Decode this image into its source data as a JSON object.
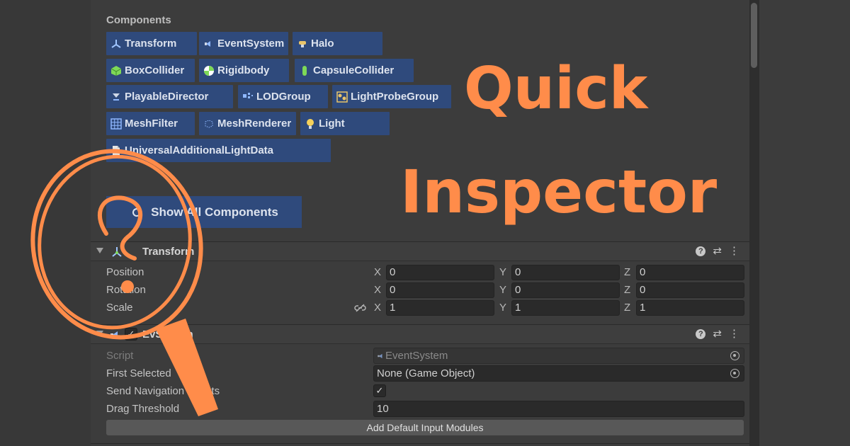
{
  "components_header": "Components",
  "chips": [
    {
      "label": "Transform",
      "icon": "transform-icon"
    },
    {
      "label": "EventSystem",
      "icon": "eventsystem-icon"
    },
    {
      "label": "Halo",
      "icon": "halo-icon"
    },
    {
      "label": "BoxCollider",
      "icon": "boxcollider-icon"
    },
    {
      "label": "Rigidbody",
      "icon": "rigidbody-icon"
    },
    {
      "label": "CapsuleCollider",
      "icon": "capsulecollider-icon"
    },
    {
      "label": "PlayableDirector",
      "icon": "playabledirector-icon"
    },
    {
      "label": "LODGroup",
      "icon": "lodgroup-icon"
    },
    {
      "label": "LightProbeGroup",
      "icon": "lightprobegroup-icon"
    },
    {
      "label": "MeshFilter",
      "icon": "meshfilter-icon"
    },
    {
      "label": "MeshRenderer",
      "icon": "meshrenderer-icon"
    },
    {
      "label": "Light",
      "icon": "light-icon"
    },
    {
      "label": "UniversalAdditionalLightData",
      "icon": "script-icon"
    }
  ],
  "show_all_label": "Show All Components",
  "transform": {
    "title": "Transform",
    "rows": [
      {
        "label": "Position",
        "x": "0",
        "y": "0",
        "z": "0"
      },
      {
        "label": "Rotation",
        "x": "0",
        "y": "0",
        "z": "0"
      },
      {
        "label": "Scale",
        "x": "1",
        "y": "1",
        "z": "1"
      }
    ],
    "axis_x": "X",
    "axis_y": "Y",
    "axis_z": "Z"
  },
  "eventsystem": {
    "title": "EventSystem",
    "title_visible": "Ev",
    "title_visible_tail": "System",
    "script_label": "Script",
    "script_value": "EventSystem",
    "first_selected_label": "First Selected",
    "first_selected_value": "None (Game Object)",
    "send_nav_label": "Send Navigation Events",
    "send_nav_checked": true,
    "drag_threshold_label": "Drag Threshold",
    "drag_threshold_value": "10",
    "add_modules_label": "Add Default Input Modules"
  },
  "overlay": {
    "line1": "Quick",
    "line2": "Inspector",
    "color": "#ff8c4a"
  },
  "colors": {
    "chip_bg": "#2f4a7c",
    "panel_bg": "#3c3c3c"
  }
}
